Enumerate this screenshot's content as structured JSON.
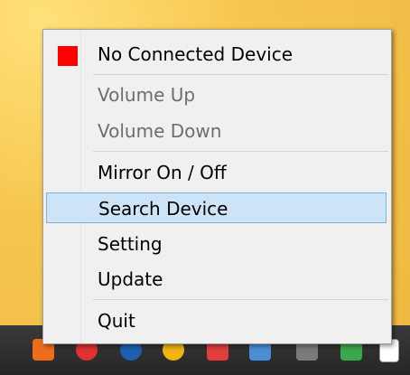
{
  "menu": {
    "status": {
      "label": "No Connected Device",
      "color": "#ff0000"
    },
    "volume_up": "Volume Up",
    "volume_down": "Volume Down",
    "mirror": "Mirror On / Off",
    "search": "Search Device",
    "setting": "Setting",
    "update": "Update",
    "quit": "Quit",
    "highlighted_item": "Search Device"
  },
  "tray": {
    "icons": [
      "app-icon-orange",
      "app-icon-red",
      "bluetooth-icon",
      "app-icon-yellow",
      "app-icon-red-2",
      "network-icon",
      "monitor-icon",
      "shield-check-icon",
      "flag-icon"
    ]
  }
}
